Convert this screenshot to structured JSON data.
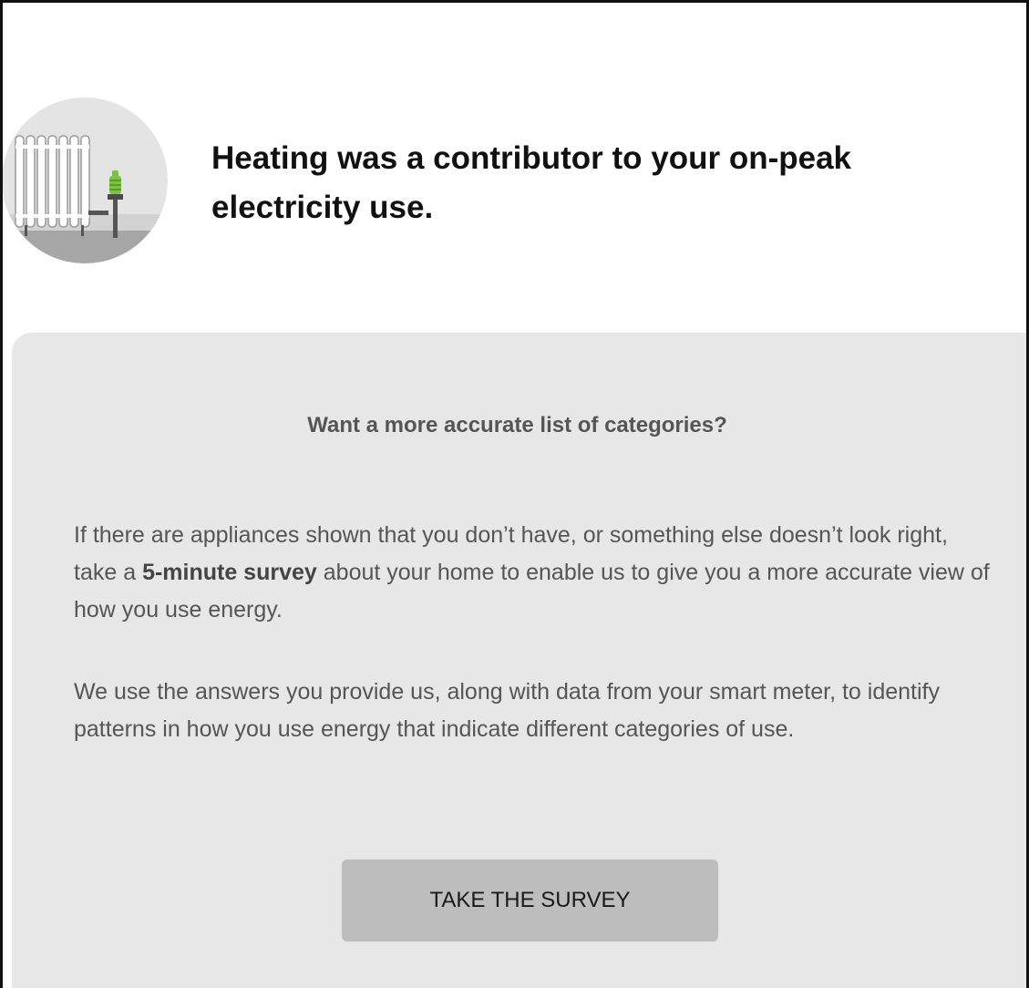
{
  "insight": {
    "headline": "Heating was a contributor to your on-peak electricity use.",
    "icon": "radiator-icon",
    "colors": {
      "icon_circle": "#e4e4e4",
      "icon_floor": "#a6a6a6",
      "thermostat_green": "#7dc242"
    }
  },
  "survey_card": {
    "title": "Want a more accurate list of categories?",
    "paragraph1": {
      "before": "If there are appliances shown that you don’t have, or something else doesn’t look right, take a ",
      "emphasis": "5-minute survey",
      "after": " about your home to enable us to give you a more accurate view of how you use energy."
    },
    "paragraph2": "We use the answers you provide us, along with data from your smart meter, to identify patterns in how you use energy that indicate different categories of use.",
    "button_label": "TAKE THE SURVEY",
    "colors": {
      "card_background": "#e7e7e7",
      "button_background": "#bdbdbd",
      "text": "#555555"
    }
  }
}
